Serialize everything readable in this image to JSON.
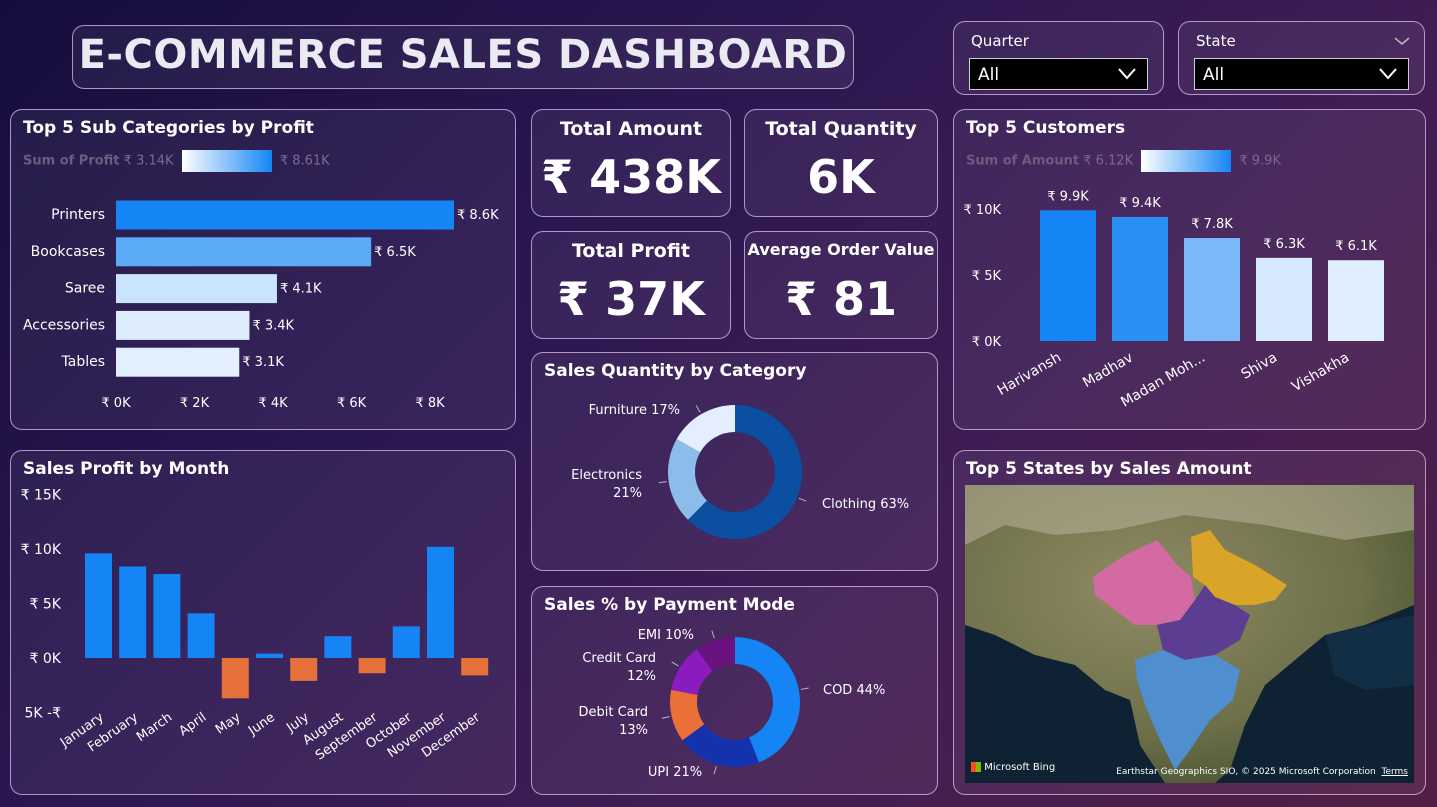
{
  "header": {
    "title": "E-COMMERCE SALES DASHBOARD"
  },
  "slicers": {
    "quarter": {
      "label": "Quarter",
      "value": "All"
    },
    "state": {
      "label": "State",
      "value": "All"
    }
  },
  "kpis": {
    "total_amount": {
      "label": "Total Amount",
      "value": "₹ 438K"
    },
    "total_quantity": {
      "label": "Total Quantity",
      "value": "6K"
    },
    "total_profit": {
      "label": "Total Profit",
      "value": "₹ 37K"
    },
    "avg_order_value": {
      "label": "Average Order Value",
      "value": "₹ 81"
    }
  },
  "subcategories": {
    "title": "Top 5 Sub Categories by Profit",
    "legend": {
      "label": "Sum of Profit",
      "min": "₹ 3.14K",
      "max": "₹ 8.61K"
    }
  },
  "customers": {
    "title": "Top 5 Customers",
    "legend": {
      "label": "Sum of Amount",
      "min": "₹ 6.12K",
      "max": "₹ 9.9K"
    }
  },
  "months": {
    "title": "Sales Profit by Month"
  },
  "category_donut": {
    "title": "Sales Quantity by Category"
  },
  "payment_donut": {
    "title": "Sales % by Payment Mode"
  },
  "states_map": {
    "title": "Top 5 States by Sales Amount",
    "bing": "Microsoft Bing",
    "credit": "Earthstar Geographics SIO, © 2025 Microsoft Corporation",
    "terms": "Terms"
  },
  "colors": {
    "deep_blue": "#1585f5",
    "mid_blue": "#5aaaf6",
    "light_blue": "#c9e4fd",
    "pale_blue": "#e1efff",
    "orange": "#e57039"
  },
  "chart_data": [
    {
      "type": "bar",
      "orientation": "horizontal",
      "categories": [
        "Printers",
        "Bookcases",
        "Saree",
        "Accessories",
        "Tables"
      ],
      "values": [
        8610,
        6500,
        4100,
        3400,
        3140
      ],
      "data_labels": [
        "₹ 8.6K",
        "₹ 6.5K",
        "₹ 4.1K",
        "₹ 3.4K",
        "₹ 3.1K"
      ],
      "xlim": [
        0,
        9000
      ],
      "xticks": [
        "₹ 0K",
        "₹ 2K",
        "₹ 4K",
        "₹ 6K",
        "₹ 8K"
      ],
      "xtick_values": [
        0,
        2000,
        4000,
        6000,
        8000
      ],
      "colors": [
        "#1585f5",
        "#5aaaf6",
        "#c9e4fd",
        "#dcecfd",
        "#e1efff"
      ]
    },
    {
      "type": "bar",
      "categories": [
        "Harivansh",
        "Madhav",
        "Madan Moh...",
        "Shiva",
        "Vishakha"
      ],
      "values": [
        9900,
        9400,
        7800,
        6300,
        6120
      ],
      "data_labels": [
        "₹ 9.9K",
        "₹ 9.4K",
        "₹ 7.8K",
        "₹ 6.3K",
        "₹ 6.1K"
      ],
      "ylim": [
        0,
        10000
      ],
      "yticks": [
        "₹ 0K",
        "₹ 5K",
        "₹ 10K"
      ],
      "ytick_values": [
        0,
        5000,
        10000
      ],
      "colors": [
        "#1585f5",
        "#2a90f5",
        "#7ab8f8",
        "#d6e9fe",
        "#dfeefe"
      ]
    },
    {
      "type": "bar",
      "categories": [
        "January",
        "February",
        "March",
        "April",
        "May",
        "June",
        "July",
        "August",
        "September",
        "October",
        "November",
        "December"
      ],
      "values": [
        9600,
        8400,
        7700,
        4100,
        -3700,
        400,
        -2100,
        2000,
        -1400,
        2900,
        10200,
        -1600
      ],
      "ylim": [
        -5000,
        15000
      ],
      "yticks": [
        "5K -₹",
        "₹ 0K",
        "₹ 5K",
        "₹ 10K",
        "₹ 15K"
      ],
      "ytick_values": [
        -5000,
        0,
        5000,
        10000,
        15000
      ],
      "positive_color": "#1585f5",
      "negative_color": "#e57039"
    },
    {
      "type": "pie",
      "donut": true,
      "labels": [
        "Clothing",
        "Electronics",
        "Furniture"
      ],
      "values": [
        63,
        21,
        17
      ],
      "label_text": [
        "Clothing 63%",
        "Electronics 21%",
        "Furniture 17%"
      ],
      "colors": [
        "#0b4fa3",
        "#8cbce9",
        "#e3efff"
      ]
    },
    {
      "type": "pie",
      "donut": true,
      "labels": [
        "COD",
        "UPI",
        "Debit Card",
        "Credit Card",
        "EMI"
      ],
      "values": [
        44,
        21,
        13,
        12,
        10
      ],
      "label_text": [
        "COD 44%",
        "UPI 21%",
        "Debit Card 13%",
        "Credit Card 12%",
        "EMI 10%"
      ],
      "colors": [
        "#1585f5",
        "#1532ad",
        "#ea7038",
        "#8a1bbf",
        "#6a127f"
      ]
    }
  ]
}
